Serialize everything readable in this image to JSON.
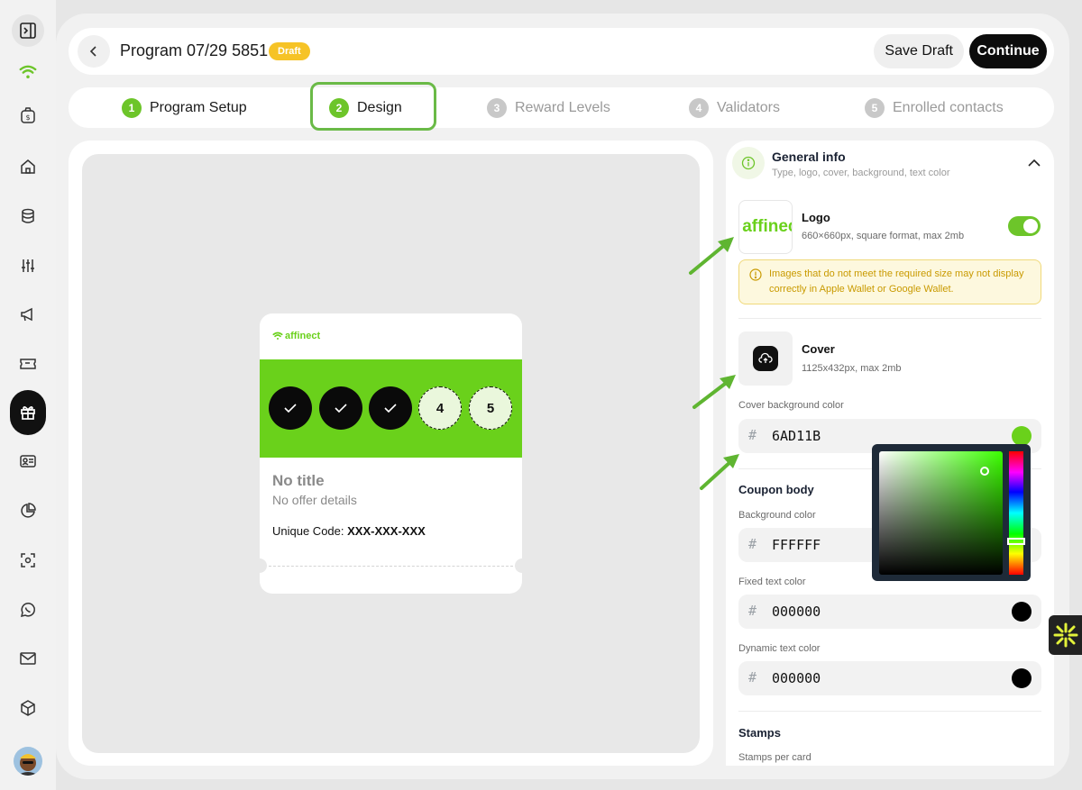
{
  "topbar": {
    "title": "Program 07/29 5851",
    "status_badge": "Draft",
    "save_draft_label": "Save Draft",
    "continue_label": "Continue"
  },
  "steps": [
    {
      "num": "1",
      "label": "Program Setup",
      "state": "done"
    },
    {
      "num": "2",
      "label": "Design",
      "state": "active"
    },
    {
      "num": "3",
      "label": "Reward Levels",
      "state": "pending"
    },
    {
      "num": "4",
      "label": "Validators",
      "state": "pending"
    },
    {
      "num": "5",
      "label": "Enrolled contacts",
      "state": "pending"
    }
  ],
  "card": {
    "logo_text": "affinect",
    "stamps": [
      {
        "type": "filled",
        "label": ""
      },
      {
        "type": "filled",
        "label": ""
      },
      {
        "type": "filled",
        "label": ""
      },
      {
        "type": "empty",
        "label": "4"
      },
      {
        "type": "empty",
        "label": "5"
      }
    ],
    "title": "No title",
    "subtitle": "No offer details",
    "code_label": "Unique Code:",
    "code_value": "XXX-XXX-XXX"
  },
  "general_info": {
    "title": "General info",
    "subtitle": "Type, logo, cover, background, text color",
    "logo": {
      "tile_text": "affinect",
      "title": "Logo",
      "subtitle": "660×660px, square format, max 2mb",
      "enabled": true
    },
    "warning": "Images that do not meet the required size may not display correctly in Apple Wallet or Google Wallet.",
    "cover": {
      "title": "Cover",
      "subtitle": "1125x432px, max 2mb"
    },
    "cover_bg": {
      "label": "Cover background color",
      "hash": "#",
      "value": "6AD11B",
      "swatch": "#6ad11b"
    }
  },
  "coupon_body": {
    "title": "Coupon body",
    "background": {
      "label": "Background color",
      "hash": "#",
      "value": "FFFFFF",
      "swatch": "#ffffff"
    },
    "fixed_text": {
      "label": "Fixed text color",
      "hash": "#",
      "value": "000000",
      "swatch": "#000000"
    },
    "dynamic_text": {
      "label": "Dynamic text color",
      "hash": "#",
      "value": "000000",
      "swatch": "#000000"
    }
  },
  "stamps_section": {
    "title": "Stamps",
    "per_card_label": "Stamps per card"
  },
  "colors": {
    "accent": "#6dc52a",
    "cover": "#6ad11b",
    "badge": "#f6c326",
    "highlight": "#6aba47"
  }
}
